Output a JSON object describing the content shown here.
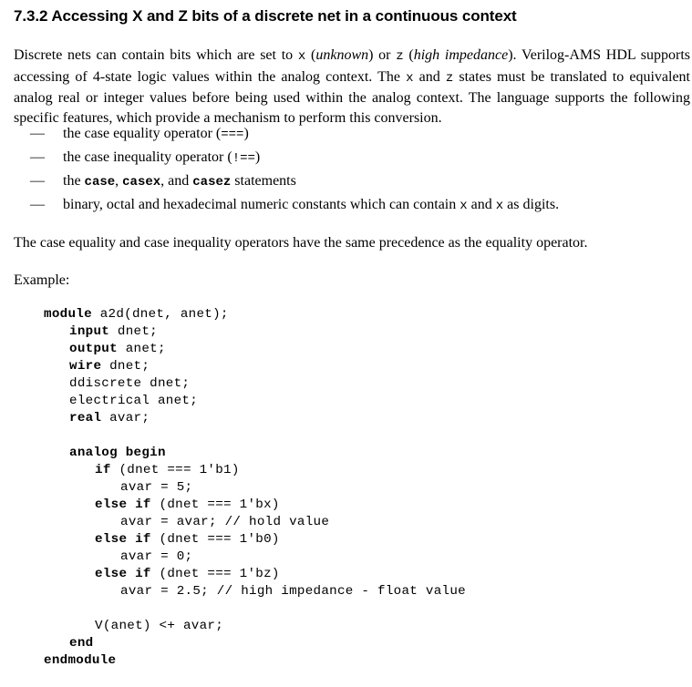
{
  "section": {
    "number": "7.3.2",
    "title": "Accessing X and Z bits of a discrete net in a continuous context"
  },
  "intro": {
    "t1": "Discrete nets can contain bits which are set to ",
    "x": "x",
    "t2": " (",
    "unknown": "unknown",
    "t3": ") or ",
    "z": "z",
    "t4": " (",
    "high_impedance": "high impedance",
    "t5": "). Verilog-AMS HDL supports accessing of 4-state logic values within the analog context. The ",
    "x2": "x",
    "t6": " and ",
    "z2": "z",
    "t7": " states must be translated to equivalent analog real or integer values before being used within the analog context. The language supports the following specific features, which provide a mechanism to perform this conversion."
  },
  "bullets": {
    "dash": "—",
    "b1": {
      "text": "the case equality operator (",
      "op": "===",
      "end": ")"
    },
    "b2": {
      "text": "the case inequality operator (",
      "op": "!==",
      "end": ")"
    },
    "b3": {
      "pre": "the ",
      "k1": "case",
      "sep1": ", ",
      "k2": "casex",
      "sep2": ", and ",
      "k3": "casez",
      "post": " statements"
    },
    "b4": {
      "text": "binary, octal and hexadecimal numeric constants which can contain ",
      "x1": "x",
      "mid": " and ",
      "x2": "x",
      "post": " as digits."
    }
  },
  "precedence_note": "The case equality and case inequality operators have the same precedence as the equality operator.",
  "example_label": "Example:",
  "code": {
    "l1_kw": "module",
    "l1_rest": " a2d(dnet, anet);",
    "l2_kw": "input",
    "l2_rest": " dnet;",
    "l3_kw": "output",
    "l3_rest": " anet;",
    "l4_kw": "wire",
    "l4_rest": " dnet;",
    "l5": "ddiscrete dnet;",
    "l6": "electrical anet;",
    "l7_kw": "real",
    "l7_rest": " avar;",
    "l8_kw": "analog begin",
    "l9_kw": "if",
    "l9_rest": " (dnet === 1'b1)",
    "l10": "avar = 5;",
    "l11_kw": "else if",
    "l11_rest": " (dnet === 1'bx)",
    "l12": "avar = avar; // hold value",
    "l13_kw": "else if",
    "l13_rest": " (dnet === 1'b0)",
    "l14": "avar = 0;",
    "l15_kw": "else if",
    "l15_rest": " (dnet === 1'bz)",
    "l16": "avar = 2.5; // high impedance - float value",
    "l17": "V(anet) <+ avar;",
    "l18_kw": "end",
    "l19_kw": "endmodule"
  }
}
